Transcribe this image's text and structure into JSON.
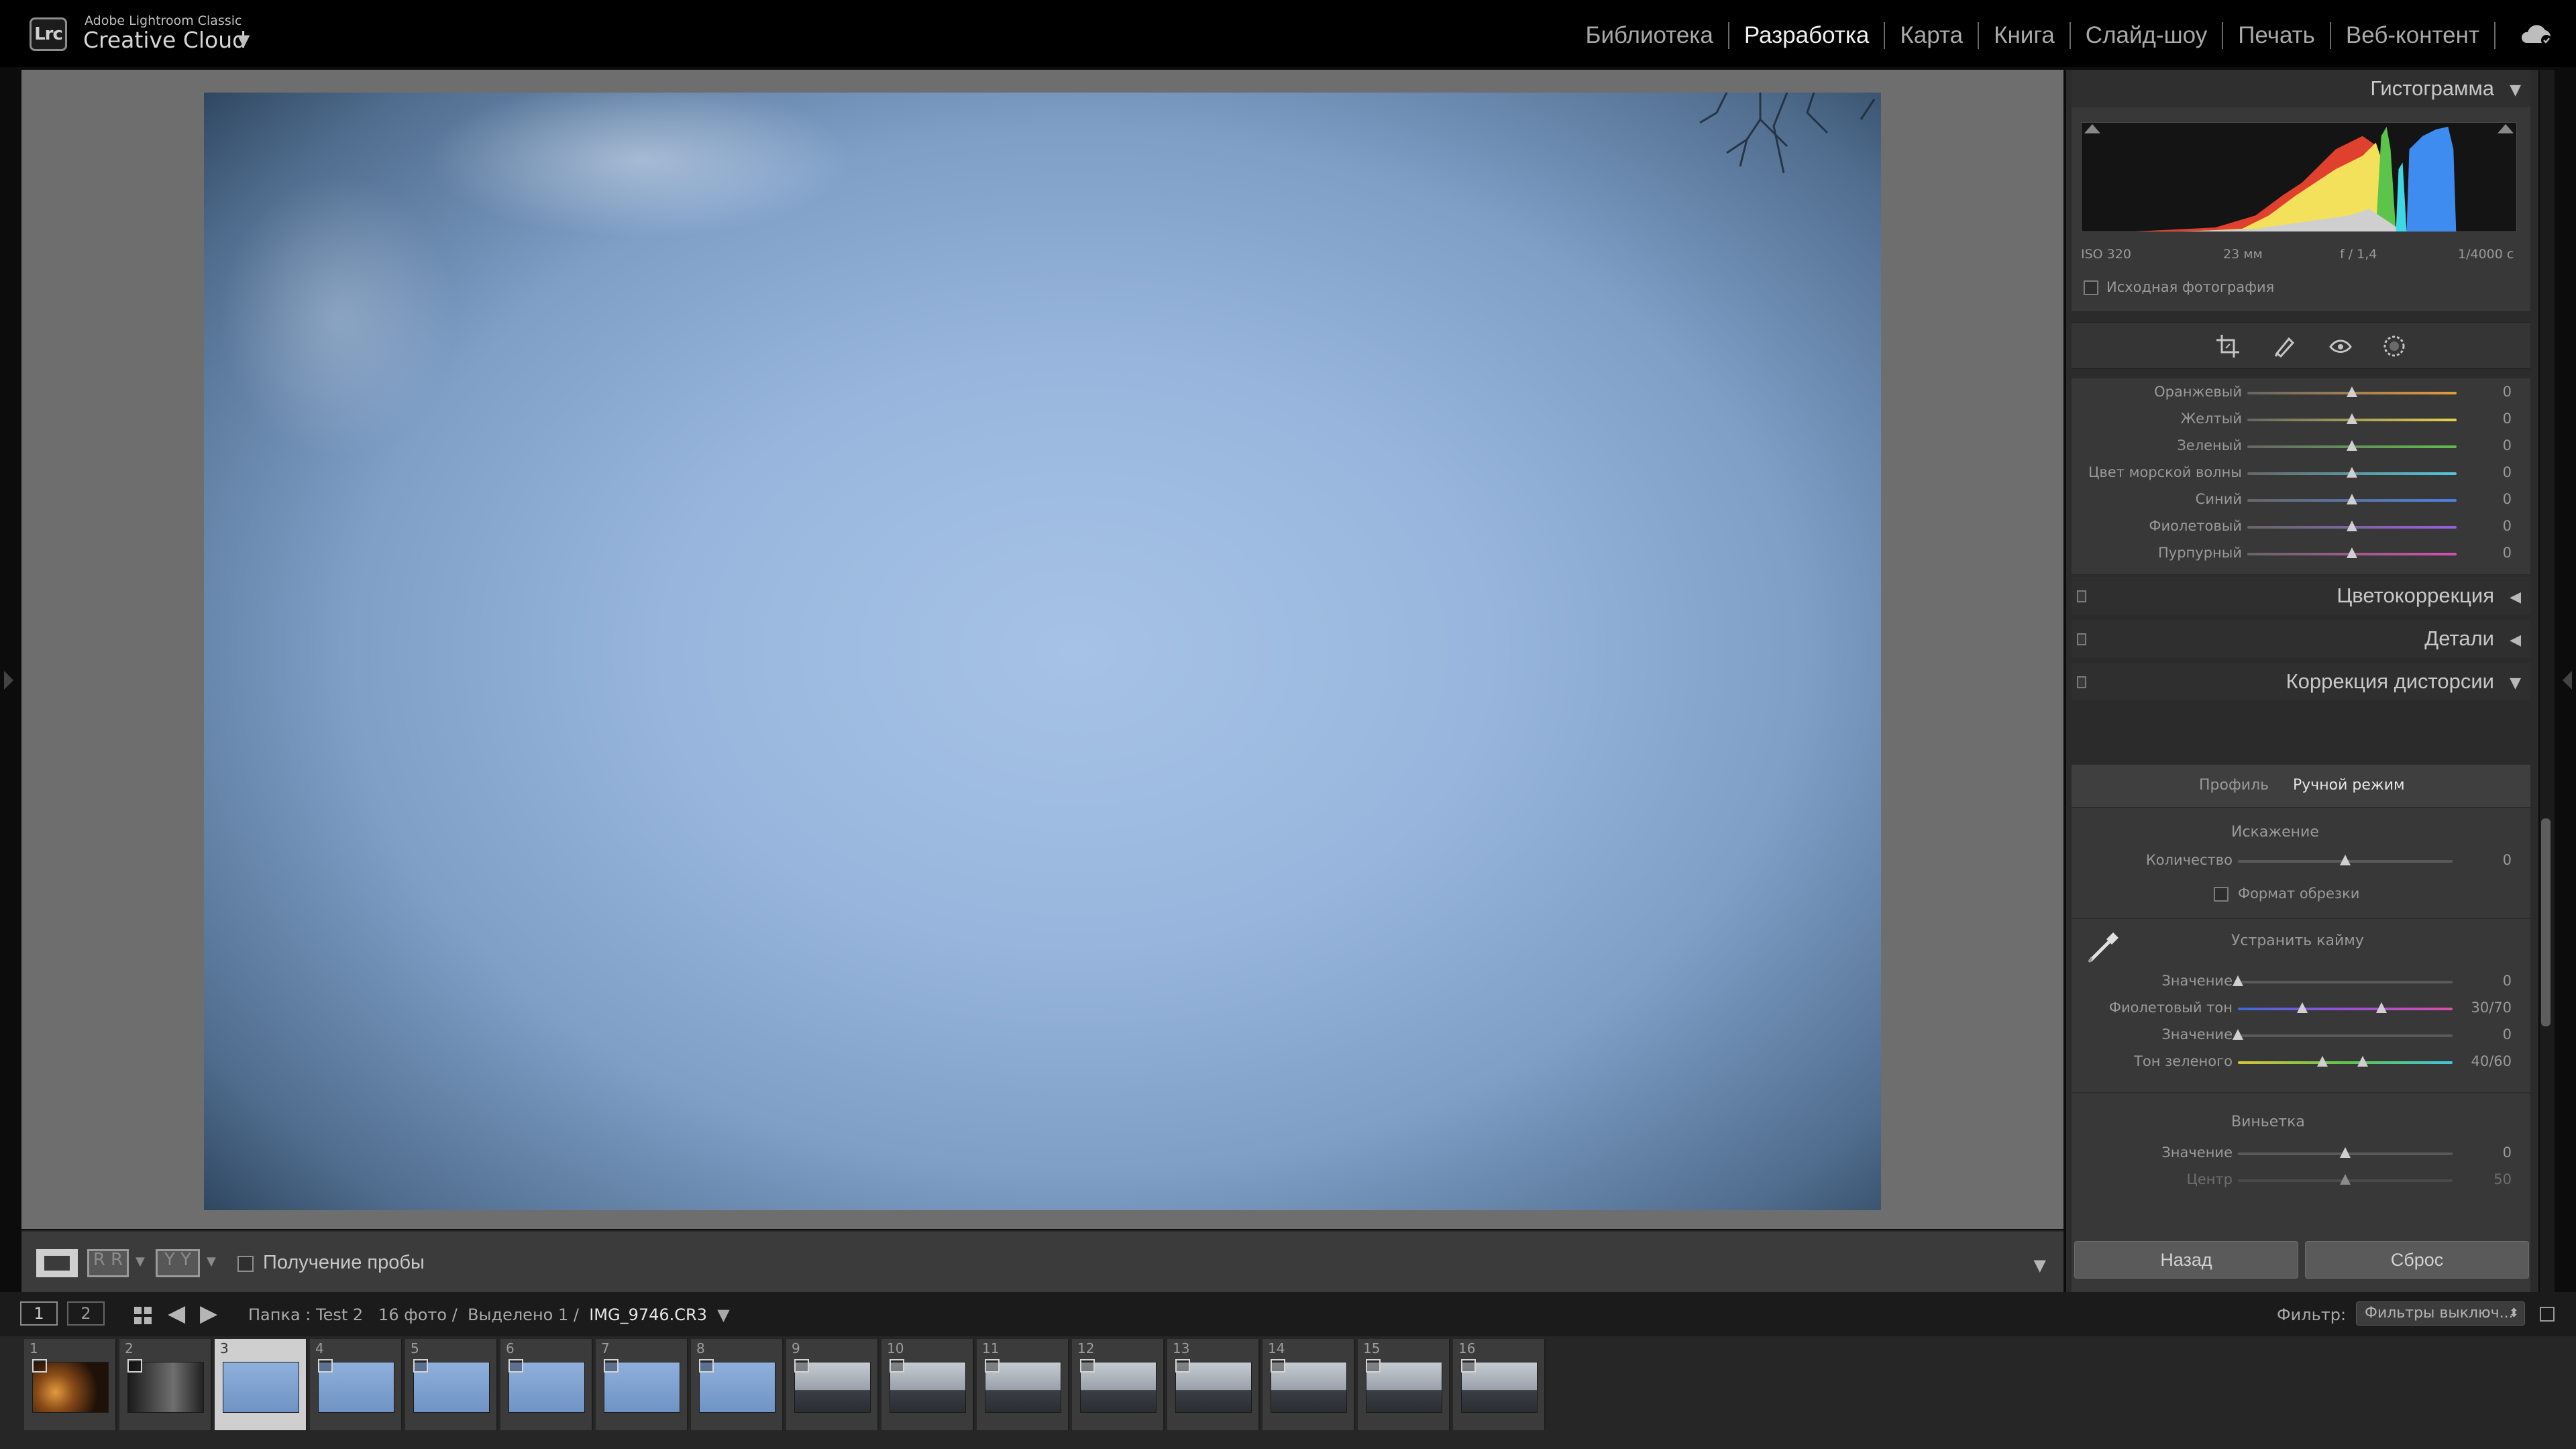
{
  "app": {
    "brand_small": "Adobe Lightroom Classic",
    "brand_big": "Creative Cloud",
    "logo": "Lrc",
    "modules": [
      "Библиотека",
      "Разработка",
      "Карта",
      "Книга",
      "Слайд-шоу",
      "Печать",
      "Веб-контент"
    ],
    "active_module": "Разработка"
  },
  "colors": {
    "panel_bg": "#2b2b2b",
    "section_bg": "#383838",
    "workspace": "#6e6e6e",
    "hist_red": "#e0412e",
    "hist_yellow": "#f3e15b",
    "hist_green": "#5cc44a",
    "hist_cyan": "#3fd6e6",
    "hist_blue": "#3f8cf0"
  },
  "panel": {
    "histogram_title": "Гистограмма",
    "hist_info": {
      "iso": "ISO 320",
      "focal": "23 мм",
      "aperture": "f / 1,4",
      "shutter": "1/4000 с"
    },
    "original_photo_label": "Исходная фотография",
    "hsl": [
      {
        "label": "Оранжевый",
        "value": "0"
      },
      {
        "label": "Желтый",
        "value": "0"
      },
      {
        "label": "Зеленый",
        "value": "0"
      },
      {
        "label": "Цвет морской волны",
        "value": "0"
      },
      {
        "label": "Синий",
        "value": "0"
      },
      {
        "label": "Фиолетовый",
        "value": "0"
      },
      {
        "label": "Пурпурный",
        "value": "0"
      }
    ],
    "color_correction_title": "Цветокоррекция",
    "details_title": "Детали",
    "lens_title": "Коррекция дисторсии",
    "lens_tabs": [
      "Профиль",
      "Ручной режим"
    ],
    "distortion_title": "Искажение",
    "amount_label": "Количество",
    "amount_value": "0",
    "crop_label": "Формат обрезки",
    "defringe_title": "Устранить кайму",
    "purple_amount_label": "Значение",
    "purple_amount_value": "0",
    "purple_hue_label": "Фиолетовый тон",
    "purple_hue_value": "30/70",
    "green_amount_label": "Значение",
    "green_amount_value": "0",
    "green_hue_label": "Тон зеленого",
    "green_hue_value": "40/60",
    "vignette_title": "Виньетка",
    "vignette_amount_label": "Значение",
    "vignette_amount_value": "0",
    "vignette_center_label": "Центр",
    "vignette_center_value": "50",
    "back_button": "Назад",
    "reset_button": "Сброс"
  },
  "toolbar": {
    "probe_label": "Получение пробы",
    "view_rr": "R R",
    "view_yy": "Y Y"
  },
  "navbar": {
    "screen1": "1",
    "screen2": "2",
    "folder": "Папка : Test 2",
    "count": "16 фото /",
    "selected": "Выделено 1 /",
    "filename": "IMG_9746.CR3",
    "filter_label": "Фильтр:",
    "filter_value": "Фильтры выключ..."
  },
  "filmstrip": {
    "items": [
      {
        "num": "1",
        "kind": "night"
      },
      {
        "num": "2",
        "kind": "dark"
      },
      {
        "num": "3",
        "kind": "sky"
      },
      {
        "num": "4",
        "kind": "sky"
      },
      {
        "num": "5",
        "kind": "sky"
      },
      {
        "num": "6",
        "kind": "sky"
      },
      {
        "num": "7",
        "kind": "sky"
      },
      {
        "num": "8",
        "kind": "sky"
      },
      {
        "num": "9",
        "kind": "land"
      },
      {
        "num": "10",
        "kind": "land"
      },
      {
        "num": "11",
        "kind": "land"
      },
      {
        "num": "12",
        "kind": "land"
      },
      {
        "num": "13",
        "kind": "land"
      },
      {
        "num": "14",
        "kind": "land"
      },
      {
        "num": "15",
        "kind": "land"
      },
      {
        "num": "16",
        "kind": "land"
      }
    ],
    "selected": "3"
  }
}
